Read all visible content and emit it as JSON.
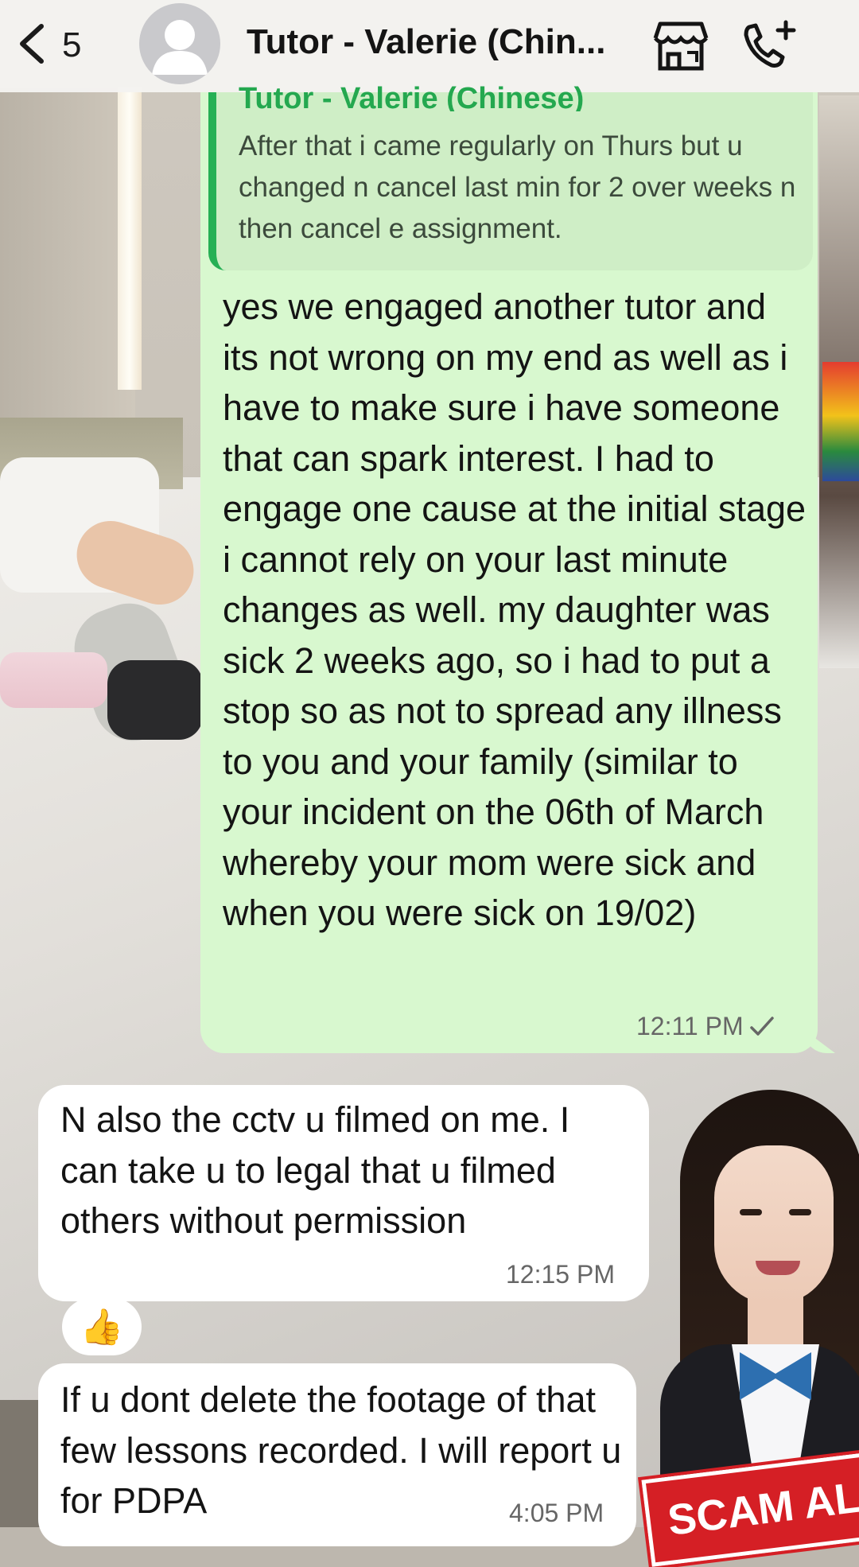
{
  "header": {
    "unread_count": "5",
    "title": "Tutor - Valerie (Chin...",
    "icons": [
      "chevron-left-icon",
      "avatar-placeholder-icon",
      "storefront-icon",
      "add-call-icon"
    ]
  },
  "messages": [
    {
      "direction": "outgoing",
      "quote": {
        "author": "Tutor - Valerie (Chinese)",
        "text": "After that i came regularly on Thurs but u changed n cancel last min for 2 over weeks n then cancel e assignment."
      },
      "text": "yes we engaged another tutor and its not wrong on my end as well as i have to make sure i have someone that can spark interest. I had to engage one cause at the initial stage i cannot rely on your last minute changes as well. my daughter was sick 2 weeks ago, so i had to put a stop so as not to spread any illness to you and your family (similar to your incident on the 06th of March whereby your mom were sick and when you were sick on 19/02)",
      "time": "12:11 PM",
      "status": "sent-check-icon"
    },
    {
      "direction": "incoming",
      "text": "N also the cctv u filmed on me. I can take u to legal that u filmed others without permission",
      "time": "12:15 PM",
      "reaction": "👍"
    },
    {
      "direction": "incoming",
      "text": "If u dont delete the footage of that few lessons recorded. I will report u for PDPA",
      "time": "4:05 PM"
    }
  ],
  "overlay": {
    "badge_text": "SCAM ALE"
  },
  "colors": {
    "outgoing_bubble": "#d8f8cf",
    "quote_bar": "#26b055",
    "quote_author": "#24a84f",
    "incoming_bubble": "#ffffff",
    "badge": "#d51f25"
  }
}
